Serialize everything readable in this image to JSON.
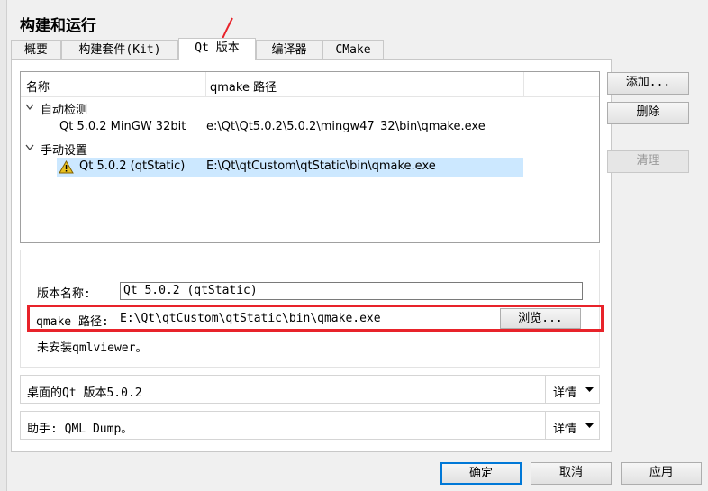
{
  "page": {
    "title": "构建和运行"
  },
  "tabs": [
    {
      "label": "概要"
    },
    {
      "label": "构建套件(Kit)"
    },
    {
      "label": "Qt 版本"
    },
    {
      "label": "编译器"
    },
    {
      "label": "CMake"
    }
  ],
  "table": {
    "columns": [
      "名称",
      "qmake 路径"
    ],
    "groups": [
      {
        "label": "自动检测",
        "rows": [
          {
            "name": "Qt 5.0.2 MinGW 32bit",
            "path": "e:\\Qt\\Qt5.0.2\\5.0.2\\mingw47_32\\bin\\qmake.exe",
            "warning": false
          }
        ]
      },
      {
        "label": "手动设置",
        "rows": [
          {
            "name": "Qt 5.0.2 (qtStatic)",
            "path": "E:\\Qt\\qtCustom\\qtStatic\\bin\\qmake.exe",
            "warning": true
          }
        ]
      }
    ]
  },
  "side_buttons": {
    "add": "添加...",
    "remove": "删除",
    "clean": "清理"
  },
  "details": {
    "version_name_label": "版本名称:",
    "version_name_value": "Qt 5.0.2 (qtStatic)",
    "qmake_path_label": "qmake 路径:",
    "qmake_path_value": "E:\\Qt\\qtCustom\\qtStatic\\bin\\qmake.exe",
    "browse_label": "浏览...",
    "qmlviewer_note": "未安装qmlviewer。"
  },
  "sections": [
    {
      "text": "桌面的Qt 版本5.0.2",
      "button": "详情"
    },
    {
      "text": "助手: QML Dump。",
      "button": "详情"
    }
  ],
  "footer": {
    "ok": "确定",
    "cancel": "取消",
    "apply": "应用"
  },
  "colors": {
    "highlight": "#cce8ff",
    "annotation": "#e8232a",
    "warning": "#c8a000"
  }
}
